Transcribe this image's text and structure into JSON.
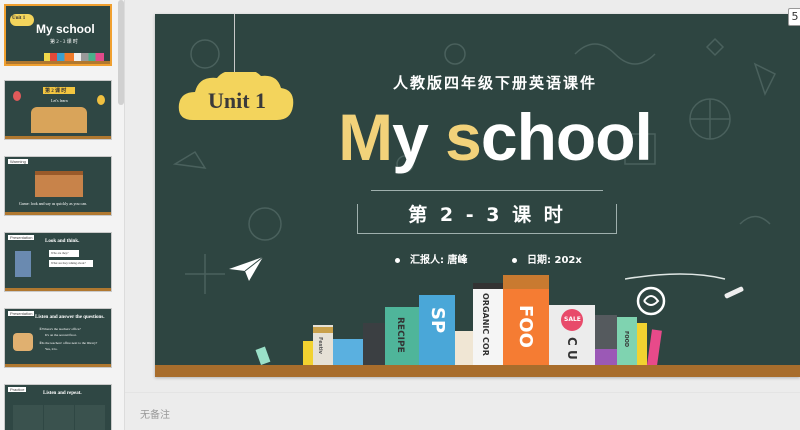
{
  "thumbnails": [
    {
      "unit": "Unit 1",
      "title": "My school",
      "lesson": "第 2 - 3 课 时"
    },
    {
      "banner": "第 2 课 时",
      "sub": "Let's learn"
    },
    {
      "tag": "Warming",
      "text": "Game: look and say as quickly as you can."
    },
    {
      "tag": "Presentation",
      "text": "Look and think.",
      "q1": "Who are they?",
      "q2": "What are they talking about?"
    },
    {
      "tag": "Presentation",
      "text": "Listen and answer the questions.",
      "q1": "①Where's the teachers' office?",
      "a1": "It's on the second floor.",
      "q2": "②Is the teachers' office next to the library?",
      "a2": "Yes, it is."
    },
    {
      "tag": "Practice",
      "text": "Listen and repeat."
    }
  ],
  "slide": {
    "unit_label": "Unit 1",
    "subtitle": "人教版四年级下册英语课件",
    "title_letter_1": "M",
    "title_part_1": "y ",
    "title_letter_2": "s",
    "title_part_2": "chool",
    "lesson": "第 2 - 3 课 时",
    "reporter": "汇报人: 唐峰",
    "date": "日期: 202x",
    "book_labels": {
      "recipe": "RECIPE",
      "sp": "SP",
      "organic": "ORGANIC COR",
      "food": "FOO",
      "sale": "SALE",
      "cu": "C U",
      "food2": "FOOD",
      "festiv": "Festiv"
    }
  },
  "page_button": "5",
  "notes_placeholder": "无备注",
  "colors": {
    "chalkboard": "#2e4541",
    "floor": "#a86d2c",
    "accent_gold": "#f2d27a",
    "active_thumb_border": "#f0a030"
  }
}
